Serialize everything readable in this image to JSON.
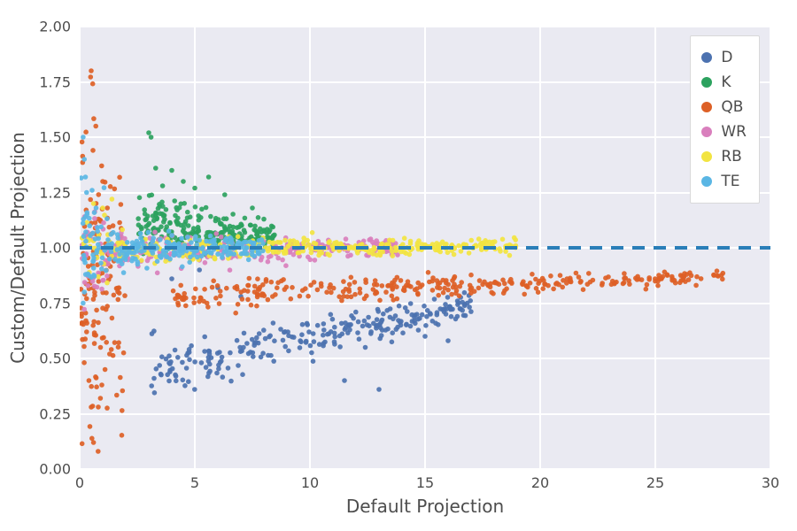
{
  "chart_data": {
    "type": "scatter",
    "xlabel": "Default Projection",
    "ylabel": "Custom/Default Projection",
    "xlim": [
      0,
      30
    ],
    "ylim": [
      0.0,
      2.0
    ],
    "xticks": [
      0,
      5,
      10,
      15,
      20,
      25,
      30
    ],
    "yticks": [
      0.0,
      0.25,
      0.5,
      0.75,
      1.0,
      1.25,
      1.5,
      1.75,
      2.0
    ],
    "reference_line": {
      "y": 1.0,
      "style": "dashed",
      "color": "#2a7eb8"
    },
    "legend_position": "upper right",
    "grid": true,
    "series": [
      {
        "name": "D",
        "color": "#4c72b0",
        "cluster": {
          "n": 260,
          "x_range": [
            3.0,
            17.0
          ],
          "y_center_start": 0.44,
          "y_center_end": 0.74,
          "y_spread": 0.12
        },
        "extra_points": [
          [
            4.0,
            0.86
          ],
          [
            5.2,
            0.9
          ],
          [
            6.0,
            0.82
          ],
          [
            7.0,
            0.78
          ],
          [
            8.4,
            0.66
          ],
          [
            15.0,
            0.6
          ],
          [
            16.0,
            0.58
          ],
          [
            13.0,
            0.36
          ],
          [
            11.5,
            0.4
          ]
        ]
      },
      {
        "name": "K",
        "color": "#2ca25f",
        "cluster": {
          "n": 240,
          "x_range": [
            2.5,
            8.5
          ],
          "y_center_start": 1.1,
          "y_center_end": 1.05,
          "y_spread": 0.12
        },
        "extra_points": [
          [
            3.1,
            1.5
          ],
          [
            3.0,
            1.52
          ],
          [
            3.3,
            1.36
          ],
          [
            3.6,
            1.28
          ],
          [
            4.0,
            1.35
          ],
          [
            4.5,
            1.3
          ],
          [
            5.0,
            1.27
          ],
          [
            5.6,
            1.32
          ],
          [
            6.3,
            1.24
          ],
          [
            7.0,
            1.1
          ],
          [
            7.5,
            1.18
          ],
          [
            8.0,
            1.08
          ]
        ]
      },
      {
        "name": "QB",
        "color": "#dd6026",
        "cluster": {
          "n": 320,
          "x_range": [
            4.0,
            28.0
          ],
          "y_center_start": 0.78,
          "y_center_end": 0.87,
          "y_spread": 0.06
        },
        "qb_low_x": {
          "n": 140,
          "x_range": [
            0.05,
            2.0
          ],
          "y_range": [
            0.05,
            1.8
          ]
        },
        "extra_points": [
          [
            0.8,
            0.08
          ],
          [
            0.6,
            0.12
          ],
          [
            0.5,
            0.28
          ],
          [
            0.4,
            0.4
          ],
          [
            0.3,
            0.62
          ],
          [
            0.9,
            0.32
          ],
          [
            1.1,
            0.45
          ],
          [
            1.3,
            0.52
          ],
          [
            0.7,
            1.55
          ],
          [
            0.5,
            1.8
          ],
          [
            1.0,
            1.3
          ],
          [
            1.2,
            1.18
          ]
        ]
      },
      {
        "name": "WR",
        "color": "#d97fbd",
        "cluster": {
          "n": 300,
          "x_range": [
            0.1,
            14.0
          ],
          "y_center_start": 0.98,
          "y_center_end": 1.0,
          "y_spread": 0.07
        },
        "extra_points": []
      },
      {
        "name": "RB",
        "color": "#f2e441",
        "cluster": {
          "n": 330,
          "x_range": [
            0.1,
            19.0
          ],
          "y_center_start": 0.99,
          "y_center_end": 1.01,
          "y_spread": 0.06
        },
        "extra_points": [
          [
            0.6,
            1.2
          ],
          [
            1.0,
            1.18
          ],
          [
            1.4,
            1.22
          ],
          [
            17.5,
            1.02
          ],
          [
            18.5,
            1.0
          ]
        ]
      },
      {
        "name": "TE",
        "color": "#5ab6e4",
        "cluster": {
          "n": 260,
          "x_range": [
            0.05,
            8.0
          ],
          "y_center_start": 1.0,
          "y_center_end": 1.0,
          "y_spread": 0.08
        },
        "extra_points": [
          [
            0.15,
            1.5
          ],
          [
            0.2,
            1.4
          ],
          [
            0.25,
            1.32
          ],
          [
            0.3,
            1.25
          ],
          [
            0.15,
            0.75
          ],
          [
            0.2,
            0.8
          ]
        ]
      }
    ]
  },
  "ytick_labels": [
    "0.00",
    "0.25",
    "0.50",
    "0.75",
    "1.00",
    "1.25",
    "1.50",
    "1.75",
    "2.00"
  ],
  "xtick_labels": [
    "0",
    "5",
    "10",
    "15",
    "20",
    "25",
    "30"
  ]
}
